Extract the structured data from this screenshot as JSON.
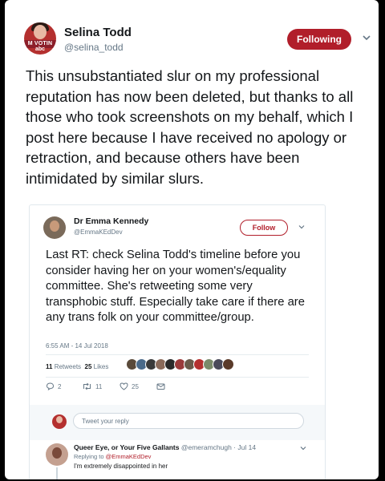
{
  "tweet": {
    "author_name": "Selina Todd",
    "author_handle": "@selina_todd",
    "avatar_badge_line1": "M VOTIN",
    "avatar_badge_line2": "abc",
    "follow_label": "Following",
    "text": "This unsubstantiated slur on my professional reputation has now been deleted, but thanks to all those who took screenshots on my behalf, which I post here because I have received no apology or retraction, and because others have been intimidated by similar slurs."
  },
  "embedded": {
    "author_name": "Dr Emma Kennedy",
    "author_handle": "@EmmaKEdDev",
    "follow_label": "Follow",
    "text": "Last RT: check Selina Todd's timeline before you consider having her on your women's/equality committee. She's retweeting some very transphobic stuff. Especially take care if there are any trans folk on your committee/group.",
    "timestamp": "6:55 AM - 14 Jul 2018",
    "retweets_count": "11",
    "retweets_label": "Retweets",
    "likes_count": "25",
    "likes_label": "Likes",
    "liker_colors": [
      "#5a4a3a",
      "#4a6a8a",
      "#3a3a3a",
      "#8a6a5a",
      "#2a2a2a",
      "#9a3a3a",
      "#6a5a4a",
      "#b4302f",
      "#7a8a6a",
      "#4a4a5a",
      "#5a3a2a"
    ],
    "actions": {
      "replies": "2",
      "retweets": "11",
      "likes": "25"
    },
    "reply_placeholder": "Tweet your reply",
    "reply": {
      "name": "Queer Eye, or Your Five Gallants",
      "handle_time": "@emeramchugh · Jul 14",
      "replying_prefix": "Replying to",
      "replying_handle": "@EmmaKEdDev",
      "text": "I'm extremely disappointed in her"
    }
  },
  "colors": {
    "accent": "#b11e2a",
    "text": "#14171a",
    "muted": "#657786"
  }
}
